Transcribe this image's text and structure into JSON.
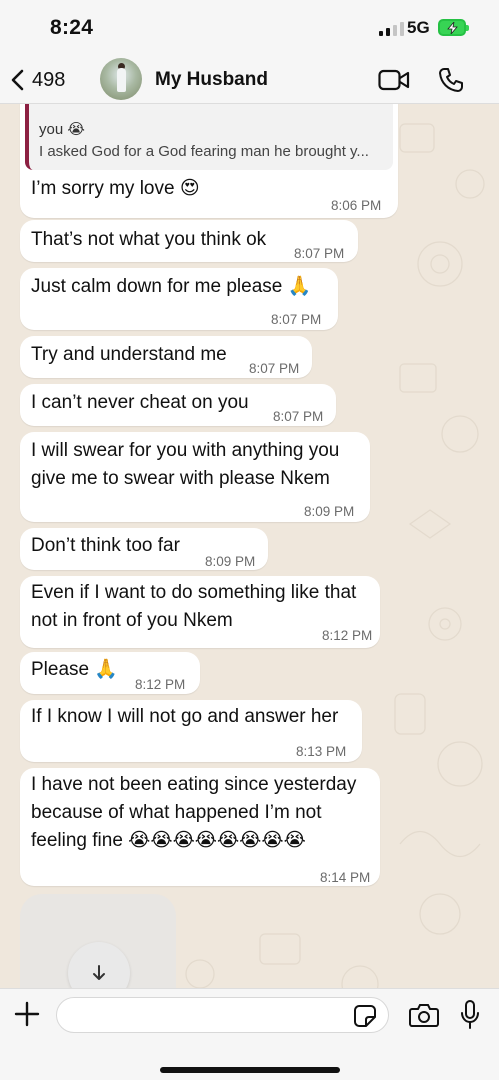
{
  "status_bar": {
    "time": "8:24",
    "network": "5G"
  },
  "header": {
    "back_count": "498",
    "contact_name": "My Husband"
  },
  "quoted": {
    "line1": "you 😭",
    "line2": "I asked God for a God fearing man he brought y..."
  },
  "messages": [
    {
      "text": "I’m sorry my love 😍",
      "time": "8:06 PM"
    },
    {
      "text": "That’s not what you think ok",
      "time": "8:07 PM"
    },
    {
      "text": "Just calm down for me please 🙏",
      "time": "8:07 PM"
    },
    {
      "text": "Try and understand me",
      "time": "8:07 PM"
    },
    {
      "text": "I can’t never cheat on you",
      "time": "8:07 PM"
    },
    {
      "line1": "I will swear for you with anything you",
      "line2": "give me to swear with please Nkem",
      "time": "8:09 PM"
    },
    {
      "text": "Don’t think too far",
      "time": "8:09 PM"
    },
    {
      "line1": "Even if I want to do something like that",
      "line2": "not in front of you Nkem",
      "time": "8:12 PM"
    },
    {
      "text": "Please 🙏",
      "time": "8:12 PM"
    },
    {
      "text": "If I know I will not go and answer her",
      "time": "8:13 PM"
    },
    {
      "line1": "I have not been eating since yesterday",
      "line2": "because of what happened I’m not",
      "line3": "feeling fine 😭😭😭😭😭😭😭😭",
      "time": "8:14 PM"
    }
  ],
  "input": {
    "placeholder": ""
  }
}
